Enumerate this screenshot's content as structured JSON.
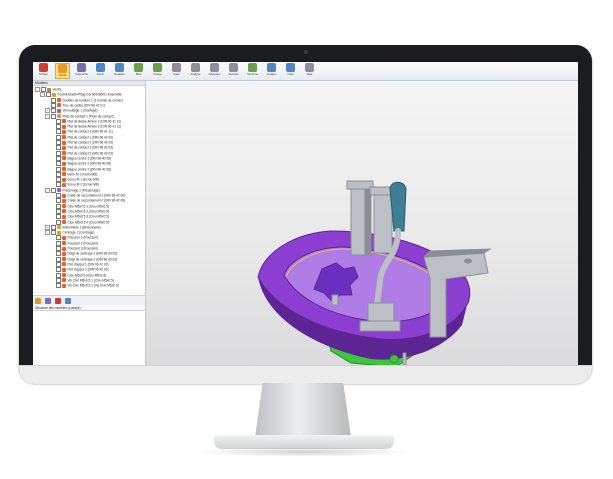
{
  "ribbon": {
    "buttons": [
      {
        "label": "Fichier",
        "color": "#d33b2c",
        "active": false
      },
      {
        "label": "Ouvrir",
        "color": "#e39b25",
        "active": true
      },
      {
        "label": "Cartouche",
        "color": "#7a6bb5",
        "active": false
      },
      {
        "label": "Zoom",
        "color": "#4f86c6",
        "active": false
      },
      {
        "label": "Rotation",
        "color": "#4f86c6",
        "active": false
      },
      {
        "label": "Plan",
        "color": "#6aa04a",
        "active": false
      },
      {
        "label": "Coupe",
        "color": "#6aa04a",
        "active": false
      },
      {
        "label": "Vues",
        "color": "#8f8f9a",
        "active": false
      },
      {
        "label": "Analyse",
        "color": "#8f8f9a",
        "active": false
      },
      {
        "label": "Mesures",
        "color": "#8f8f9a",
        "active": false
      },
      {
        "label": "Annoter",
        "color": "#8f8f9a",
        "active": false
      },
      {
        "label": "Sections",
        "color": "#6aa04a",
        "active": false
      },
      {
        "label": "Images",
        "color": "#4f86c6",
        "active": false
      },
      {
        "label": "Infos",
        "color": "#4f86c6",
        "active": false
      },
      {
        "label": "Aide",
        "color": "#8f8f9a",
        "active": false
      }
    ]
  },
  "panel": {
    "title": "Modèles",
    "footer": "Structure des modèles (Lunape)"
  },
  "tree": [
    {
      "depth": 0,
      "label": "Ventiv",
      "color": "#b58a3a",
      "exp": "-"
    },
    {
      "depth": 1,
      "label": "Fournit Etabli+Pitag GS 900080/01 Ensemble",
      "color": "#d8a330",
      "exp": "-"
    },
    {
      "depth": 2,
      "label": "Douilles de bordure 1 (1 fournie de nomen)",
      "color": "#e3622a",
      "exp": ""
    },
    {
      "depth": 2,
      "label": "Trou de centre (DIN 96 42 01)",
      "color": "#e3622a",
      "exp": ""
    },
    {
      "depth": 2,
      "label": "Verrouillage 1 (montage)",
      "color": "#8e63c4",
      "exp": "+"
    },
    {
      "depth": 2,
      "label": "Plots de contact 1 (Plots de contact)",
      "color": "#d8a330",
      "exp": "-"
    },
    {
      "depth": 3,
      "label": "Plot de Butée Arrière 2 (DIN 96 41 11)",
      "color": "#e3622a",
      "exp": ""
    },
    {
      "depth": 3,
      "label": "Plot de Butée Arrière 2 (DIN 96 41 11)",
      "color": "#e3622a",
      "exp": ""
    },
    {
      "depth": 3,
      "label": "Plot de contact 1 (DIN 96 41 11)",
      "color": "#e3622a",
      "exp": ""
    },
    {
      "depth": 3,
      "label": "Plot de contact 1 (DIN 96 42 03)",
      "color": "#e3622a",
      "exp": ""
    },
    {
      "depth": 3,
      "label": "Plot de contact 2 (DIN 96 42 03)",
      "color": "#e3622a",
      "exp": ""
    },
    {
      "depth": 3,
      "label": "Plot de contact 1 (DIN 96 42 03)",
      "color": "#e3622a",
      "exp": ""
    },
    {
      "depth": 3,
      "label": "Plot de contact 2 (DIN 96 42 03)",
      "color": "#e3622a",
      "exp": ""
    },
    {
      "depth": 3,
      "label": "Bague centre 1 (DIN 96 40 08)",
      "color": "#e3622a",
      "exp": ""
    },
    {
      "depth": 3,
      "label": "Bague centre 2 (DIN 96 40 08)",
      "color": "#e3622a",
      "exp": ""
    },
    {
      "depth": 3,
      "label": "Bague centre 2 (DIN 96 40 08)",
      "color": "#e3622a",
      "exp": ""
    },
    {
      "depth": 3,
      "label": "Vérin M 1 (Vérin M8)",
      "color": "#e3622a",
      "exp": ""
    },
    {
      "depth": 3,
      "label": "Ecrou M 1 (Ecrou M8)",
      "color": "#e3622a",
      "exp": ""
    },
    {
      "depth": 3,
      "label": "Ecrou M 2 (Ecrou M8)",
      "color": "#e3622a",
      "exp": ""
    },
    {
      "depth": 2,
      "label": "Préserrage 1 (Préserrage)",
      "color": "#8e63c4",
      "exp": "-"
    },
    {
      "depth": 3,
      "label": "Crelle de raccordement 1 (DIN 96 42 06)",
      "color": "#e3622a",
      "exp": ""
    },
    {
      "depth": 3,
      "label": "Crelle de raccordement 1 (DIN 96 42 06)",
      "color": "#e3622a",
      "exp": ""
    },
    {
      "depth": 3,
      "label": "Clou M5x0.5 1 (Clou M5x0.5)",
      "color": "#e3622a",
      "exp": ""
    },
    {
      "depth": 3,
      "label": "Clou M5x0.5 2 (Clou M5x0.5)",
      "color": "#e3622a",
      "exp": ""
    },
    {
      "depth": 3,
      "label": "Clou M5x0.5 3 (Clou M5x0.5)",
      "color": "#e3622a",
      "exp": ""
    },
    {
      "depth": 3,
      "label": "Clou M5x0.5 4 (Clou M5x0.5)",
      "color": "#e3622a",
      "exp": ""
    },
    {
      "depth": 2,
      "label": "Bridonnerie 1 (Bridonnerie)",
      "color": "#d8a330",
      "exp": "+"
    },
    {
      "depth": 2,
      "label": "Centrage 1 (Centrage)",
      "color": "#d8a330",
      "exp": "-"
    },
    {
      "depth": 3,
      "label": "Poussoir 1 (Poussoir)",
      "color": "#e3622a",
      "exp": ""
    },
    {
      "depth": 3,
      "label": "Poussoir 2 (Poussoir)",
      "color": "#e3622a",
      "exp": ""
    },
    {
      "depth": 3,
      "label": "Poussoir 3 (Poussoir)",
      "color": "#e3622a",
      "exp": ""
    },
    {
      "depth": 3,
      "label": "Doigt de centrage 1 (DIN 96 43 03)",
      "color": "#e3622a",
      "exp": ""
    },
    {
      "depth": 3,
      "label": "Doigt de centrage 2 (DIN 96 43 03)",
      "color": "#e3622a",
      "exp": ""
    },
    {
      "depth": 3,
      "label": "Plot d'appui 1 (DIN 96 42 03)",
      "color": "#e3622a",
      "exp": ""
    },
    {
      "depth": 3,
      "label": "Plot d'appui 2 (DIN 96 42 03)",
      "color": "#e3622a",
      "exp": ""
    },
    {
      "depth": 3,
      "label": "Clou M5x0.5 (Clou M5x0.5)",
      "color": "#e3622a",
      "exp": ""
    },
    {
      "depth": 3,
      "label": "Vis CHc M5x0.5 1 (Clou M5x0.5)",
      "color": "#e3622a",
      "exp": ""
    },
    {
      "depth": 3,
      "label": "Vis CHc M5x0.5 2 (Vis CHc M5x0.5)",
      "color": "#e3622a",
      "exp": ""
    }
  ],
  "tools": [
    {
      "name": "add-tool-icon",
      "color": "#e39b25"
    },
    {
      "name": "edit-tool-icon",
      "color": "#7a6bb5"
    },
    {
      "name": "delete-tool-icon",
      "color": "#d33b2c"
    },
    {
      "name": "properties-tool-icon",
      "color": "#4f86c6"
    }
  ],
  "model_colors": {
    "shell": "#8b3fd1",
    "shell_dark": "#5d2593",
    "shell_light": "#b07de6",
    "metal": "#bcc0c6",
    "metal_dark": "#8a8e95",
    "knob": "#6b2fc0",
    "handle": "#3f7f96",
    "green": "#3ec43e"
  }
}
